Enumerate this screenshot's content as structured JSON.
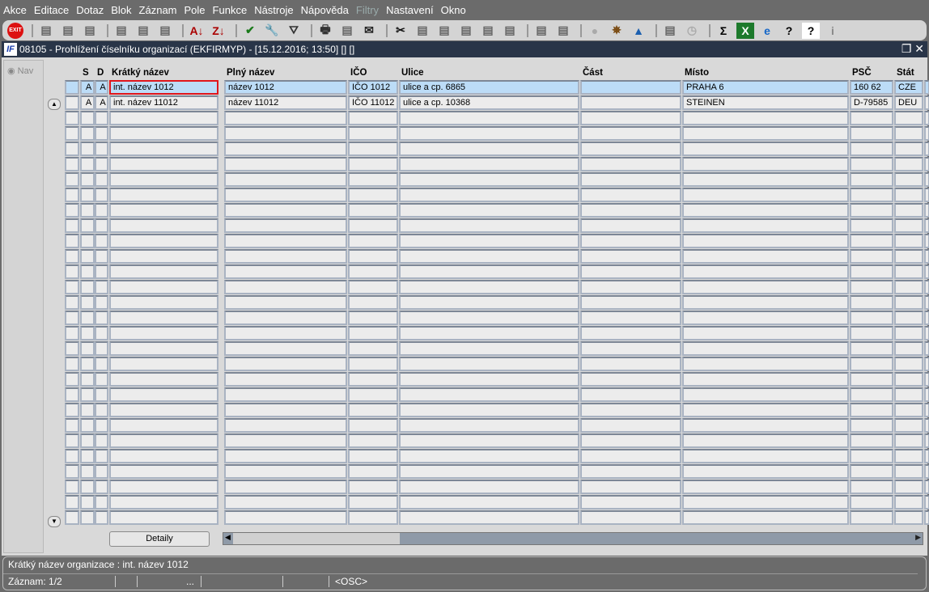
{
  "menu": [
    "Akce",
    "Editace",
    "Dotaz",
    "Blok",
    "Záznam",
    "Pole",
    "Funkce",
    "Nástroje",
    "Nápověda",
    "Filtry",
    "Nastavení",
    "Okno"
  ],
  "menu_disabled": [
    "Filtry"
  ],
  "toolbar": [
    "exit-icon",
    "add-record-icon",
    "duplicate-record-icon",
    "delete-record-icon",
    "query-enter-icon",
    "query-execute-icon",
    "query-cancel-icon",
    "sort-asc-icon",
    "sort-desc-icon",
    "save-check-icon",
    "tools-icon",
    "filter-icon",
    "print-icon",
    "print-setup-icon",
    "mail-icon",
    "cut-icon",
    "copy-icon",
    "paste-icon",
    "zoom-icon",
    "list-icon",
    "tree-icon",
    "export-icon",
    "document-icon",
    "globe-icon",
    "wheel-icon",
    "eye-icon",
    "report-icon",
    "clock-icon",
    "sum-icon",
    "excel-icon",
    "ie-icon",
    "help-icon",
    "context-help-icon",
    "info-icon"
  ],
  "window": {
    "title": "08105 - Prohlížení číselníku organizací (EKFIRMYP) - [15.12.2016; 13:50] [] []"
  },
  "nav": {
    "label": "Nav"
  },
  "columns": [
    "S",
    "D",
    "Krátký název",
    "Plný název",
    "IČO",
    "Ulice",
    "Část",
    "Místo",
    "PSČ",
    "Stát"
  ],
  "rows": [
    [
      "A",
      "A",
      "int. název 1012",
      "název 1012",
      "IČO 1012",
      "ulice a cp. 6865",
      "",
      "PRAHA 6",
      "160 62",
      "CZE"
    ],
    [
      "A",
      "A",
      "int. název 11012",
      "název 11012",
      "IČO 11012",
      "ulice a cp. 10368",
      "",
      "STEINEN",
      "D-79585",
      "DEU"
    ]
  ],
  "detail_button": "Detaily",
  "status": {
    "hint": "Krátký název organizace : int. název 1012",
    "record": "Záznam: 1/2",
    "ellipsis": "...",
    "mode": "<OSC>"
  }
}
